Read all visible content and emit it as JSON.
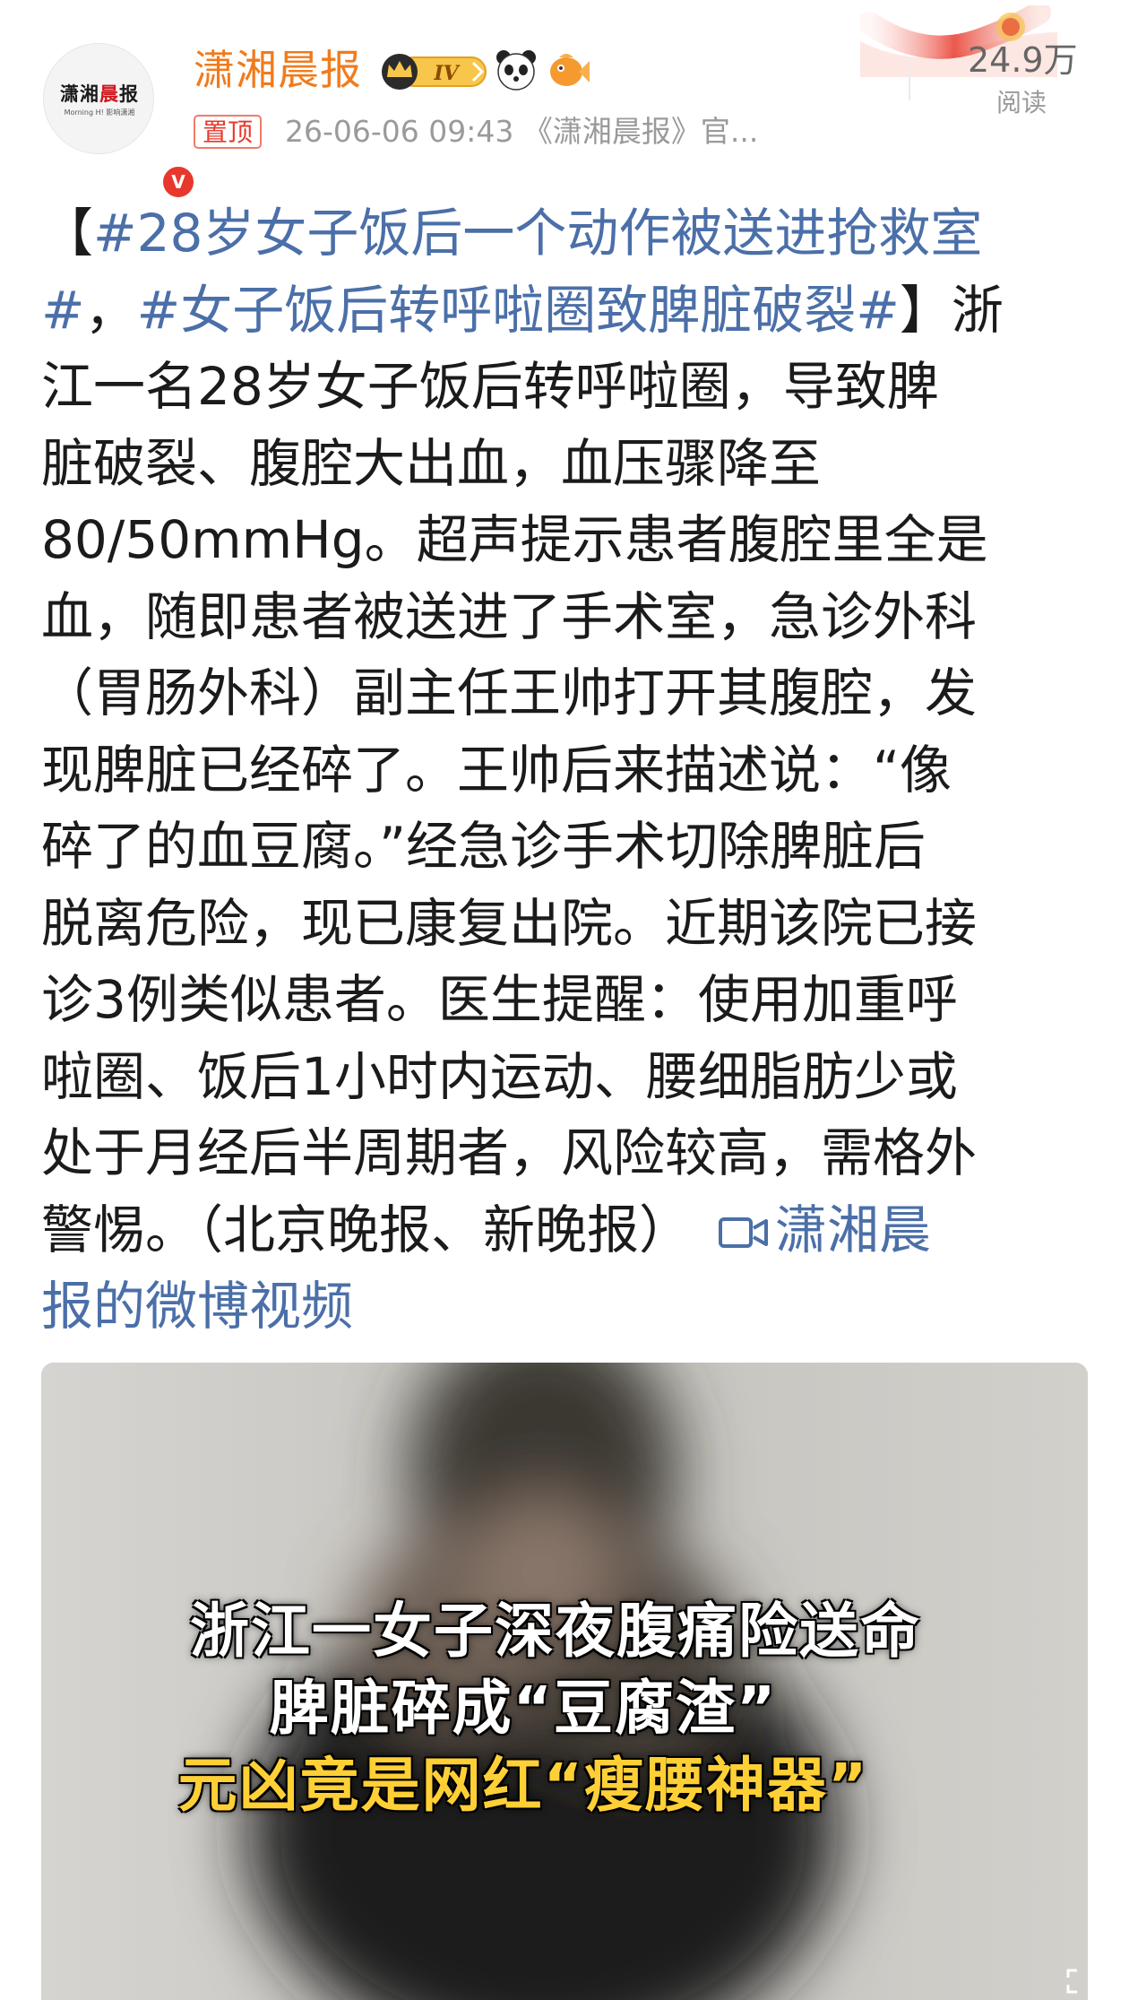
{
  "post": {
    "author": "潇湘晨报",
    "level_badge": "IV",
    "avatar_logo_main_a": "潇湘",
    "avatar_logo_main_b": "晨",
    "avatar_logo_main_c": "报",
    "avatar_logo_sub": "Morning H! 影响潇湘",
    "verified_mark": "V",
    "pinned_label": "置顶",
    "meta": "26-06-06 09:43  《潇湘晨报》官...",
    "read_count": "24.9万",
    "read_label": "阅读"
  },
  "body": {
    "lines": [
      [
        {
          "t": "【",
          "k": "text"
        },
        {
          "t": "#28岁女子饭后一个动作被送进抢救室",
          "k": "tag"
        }
      ],
      [
        {
          "t": "#",
          "k": "tag"
        },
        {
          "t": "，",
          "k": "text"
        },
        {
          "t": "#女子饭后转呼啦圈致脾脏破裂#",
          "k": "tag"
        },
        {
          "t": "】浙",
          "k": "text"
        }
      ],
      [
        {
          "t": "江一名28岁女子饭后转呼啦圈，导致脾",
          "k": "text"
        }
      ],
      [
        {
          "t": "脏破裂、腹腔大出血，血压骤降至",
          "k": "text"
        }
      ],
      [
        {
          "t": "80/50mmHg。超声提示患者腹腔里全是",
          "k": "text"
        }
      ],
      [
        {
          "t": "血，随即患者被送进了手术室，急诊外科",
          "k": "text"
        }
      ],
      [
        {
          "t": "（胃肠外科）副主任王帅打开其腹腔，发",
          "k": "text"
        }
      ],
      [
        {
          "t": "现脾脏已经碎了。王帅后来描述说：“像",
          "k": "text"
        }
      ],
      [
        {
          "t": "碎了的血豆腐。”经急诊手术切除脾脏后",
          "k": "text"
        }
      ],
      [
        {
          "t": "脱离危险，现已康复出院。近期该院已接",
          "k": "text"
        }
      ],
      [
        {
          "t": "诊3例类似患者。医生提醒：使用加重呼",
          "k": "text"
        }
      ],
      [
        {
          "t": "啦圈、饭后1小时内运动、腰细脂肪少或",
          "k": "text"
        }
      ],
      [
        {
          "t": "处于月经后半周期者，风险较高，需格外",
          "k": "text"
        }
      ],
      [
        {
          "t": "警惕。（北京晚报、新晚报）",
          "k": "text"
        },
        {
          "t": "潇湘晨",
          "k": "video"
        }
      ],
      [
        {
          "t": "报的微博视频",
          "k": "video"
        }
      ]
    ]
  },
  "video": {
    "caption_line1": "浙江一女子深夜腹痛险送命",
    "caption_line2": "脾脏碎成“豆腐渣”",
    "caption_line3": "元凶竟是网红“瘦腰神器”"
  },
  "icons": {
    "verified": "verified-v-icon",
    "crown": "crown-level-icon",
    "panda": "panda-icon",
    "fish": "fish-icon",
    "video_link": "video-camera-icon",
    "fullscreen": "fullscreen-icon"
  },
  "colors": {
    "author": "#f07b1d",
    "hashtag": "#4b6fa8",
    "pinned_border": "#f07b6b",
    "caption_highlight": "#ffd036"
  }
}
